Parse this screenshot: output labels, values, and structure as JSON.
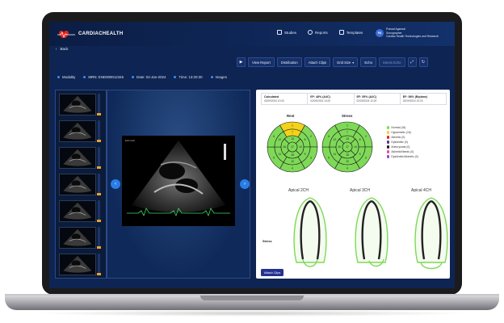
{
  "app": {
    "brand": "CARDIACHEALTH",
    "brand_sub": ""
  },
  "topnav": [
    {
      "label": "Studies",
      "icon": "studies-icon"
    },
    {
      "label": "Reports",
      "icon": "reports-icon"
    },
    {
      "label": "Templates",
      "icon": "templates-icon"
    }
  ],
  "user": {
    "initials": "PA",
    "name": "Prasad Agarwal",
    "role": "Sonographer",
    "org": "Cardiac Health Technologies and Research"
  },
  "back_label": "Back",
  "toolbar": {
    "view_report": "View Report",
    "distribution": "Distribution",
    "attach_clips": "Attach Clips",
    "grid_size": "Grid Size",
    "echo": "Echo",
    "stress_echo": "Stress Echo"
  },
  "info": {
    "modality": "Modality",
    "mrn": "MRN: END000012345",
    "date": "Date: 02-Jan-2024",
    "time": "Time: 13:20:30",
    "images": "Images"
  },
  "report": {
    "cards": [
      {
        "title": "Calculated",
        "date": "02/09/2024 10:20"
      },
      {
        "title": "EF: 48% (A4C)",
        "date": "02/09/2024 10:20"
      },
      {
        "title": "EF: 55% (A2C)",
        "date": "02/09/2024 10:20"
      },
      {
        "title": "EF: 58% (Biplane)",
        "date": "02/09/2024 10:20"
      }
    ],
    "rest_label": "Rest",
    "stress_label": "Stress",
    "stress_row_label": "Stress",
    "legend": [
      {
        "label": "Normal (16)",
        "color": "#7ed957"
      },
      {
        "label": "Hypokinetic (16)",
        "color": "#f2d21b"
      },
      {
        "label": "Akinetic (0)",
        "color": "#e2231a"
      },
      {
        "label": "Dyskinetic (0)",
        "color": "#5a2d8c"
      },
      {
        "label": "Aneurysmal (0)",
        "color": "#1c1c1c"
      },
      {
        "label": "Akinetic/Needs (0)",
        "color": "#e64aa0"
      },
      {
        "label": "Dyskinetic/Akinetic (0)",
        "color": "#9b3fd6"
      }
    ],
    "apical": [
      {
        "title": "Apical 2CH"
      },
      {
        "title": "Apical 3CH"
      },
      {
        "title": "Apical 4CH"
      }
    ],
    "attach_clips": "Attach Clips"
  },
  "colors": {
    "segment_normal": "#7ed957",
    "segment_hypokinetic": "#f2d21b",
    "accent": "#2a7de6",
    "header": "#0b1d44"
  }
}
